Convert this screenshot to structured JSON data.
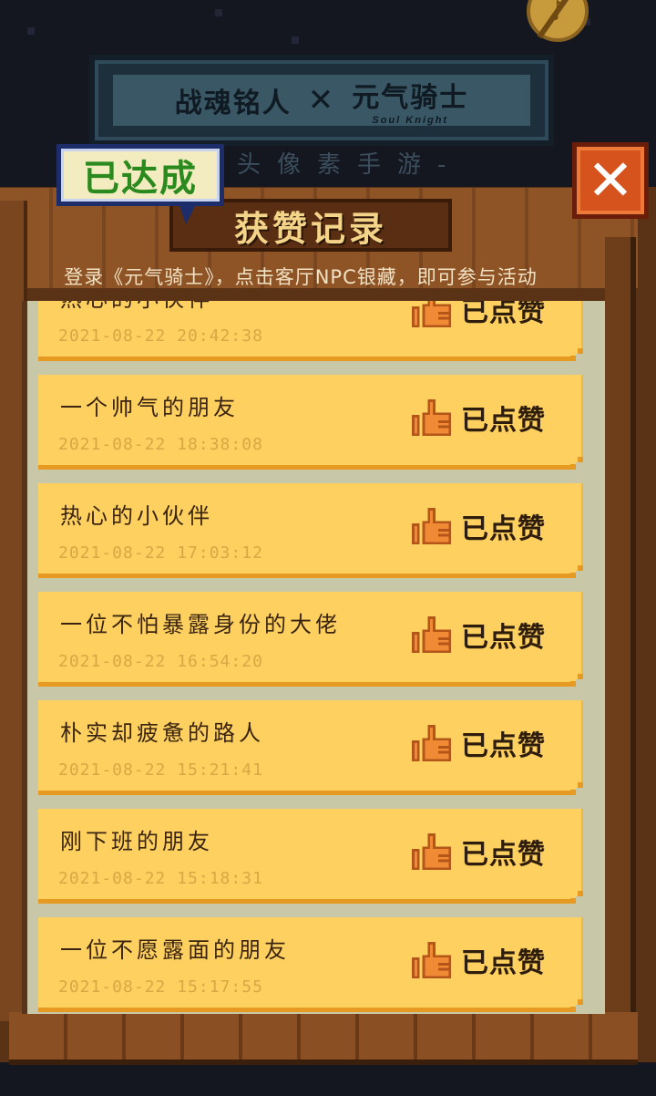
{
  "banner": {
    "logo_left": "战魂铭人",
    "cross": "✕",
    "logo_right": "元气骑士",
    "logo_right_sub": "Soul Knight",
    "subtitle": "头像素手游-"
  },
  "badge": {
    "label": "已达成"
  },
  "title": "获赞记录",
  "close_button": {
    "label": "✕"
  },
  "instruction": "登录《元气骑士》，点击客厅NPC银藏，即可参与活动",
  "music_icon": "music-note-off-icon",
  "records": [
    {
      "name": "热心的小伙伴",
      "time": "2021-08-22 20:42:38",
      "status": "已点赞"
    },
    {
      "name": "一个帅气的朋友",
      "time": "2021-08-22 18:38:08",
      "status": "已点赞"
    },
    {
      "name": "热心的小伙伴",
      "time": "2021-08-22 17:03:12",
      "status": "已点赞"
    },
    {
      "name": "一位不怕暴露身份的大佬",
      "time": "2021-08-22 16:54:20",
      "status": "已点赞"
    },
    {
      "name": "朴实却疲惫的路人",
      "time": "2021-08-22 15:21:41",
      "status": "已点赞"
    },
    {
      "name": "刚下班的朋友",
      "time": "2021-08-22 15:18:31",
      "status": "已点赞"
    },
    {
      "name": "一位不愿露面的朋友",
      "time": "2021-08-22 15:17:55",
      "status": "已点赞"
    }
  ],
  "colors": {
    "card": "#fdd060",
    "card_edge": "#e69a22",
    "badge_text": "#2a8a1e",
    "close_bg": "#d6531e",
    "thumb": "#e8832a"
  }
}
